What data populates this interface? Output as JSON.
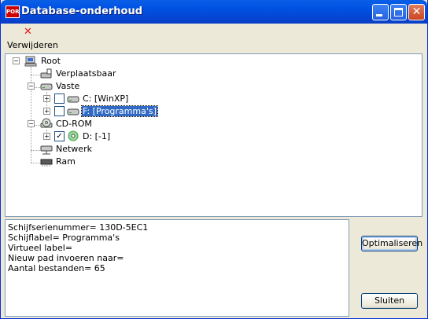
{
  "window": {
    "title": "Database-onderhoud",
    "app_icon_text": "POR"
  },
  "toolbar": {
    "delete_label": "Verwijderen"
  },
  "tree": {
    "root": "Root",
    "removable": "Verplaatsbaar",
    "fixed": "Vaste",
    "drive_c": "C: [WinXP]",
    "drive_f": "F: [Programma's]",
    "cdrom": "CD-ROM",
    "drive_d": "D: [-1]",
    "network": "Netwerk",
    "ram": "Ram"
  },
  "info": {
    "lines": [
      "Schijfserienummer= 130D-5EC1",
      "Schijflabel= Programma's",
      "Virtueel label=",
      "Nieuw pad invoeren naar=",
      "Aantal bestanden= 65"
    ]
  },
  "buttons": {
    "optimize": "Optimaliseren",
    "close": "Sluiten"
  },
  "colors": {
    "selection": "#316ac5",
    "titlebar": "#0054e3",
    "delete_icon": "#e21a1a"
  }
}
